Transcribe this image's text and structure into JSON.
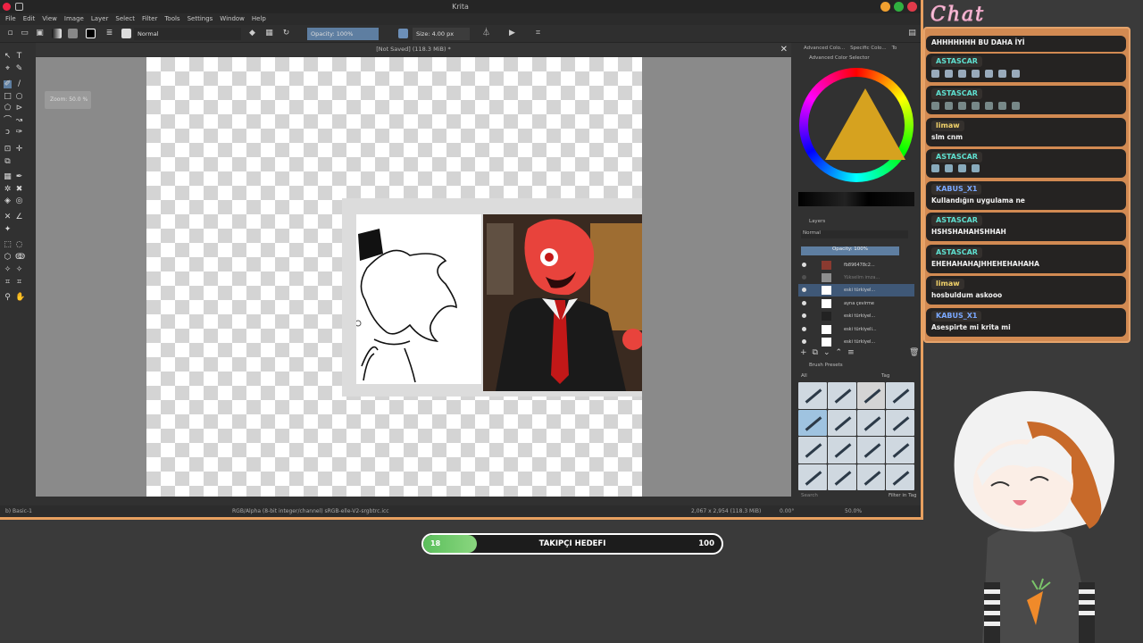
{
  "app": {
    "title": "Krita"
  },
  "menu": [
    "File",
    "Edit",
    "View",
    "Image",
    "Layer",
    "Select",
    "Filter",
    "Tools",
    "Settings",
    "Window",
    "Help"
  ],
  "toolbar": {
    "blend_mode": "Normal",
    "opacity": "Opacity: 100%",
    "size": "Size: 4.00 px"
  },
  "document": {
    "tab_title": "[Not Saved] (118.3 MiB) *"
  },
  "canvas": {
    "zoom_hint": "Zoom: 50.0 %"
  },
  "statusbar": {
    "brush": "b) Basic-1",
    "color_space": "RGB/Alpha (8-bit integer/channel) sRGB-elle-V2-srgbtrc.icc",
    "dimensions": "2,067 x 2,954 (118.3 MiB)",
    "rotation": "0.00°",
    "zoom": "50.0%"
  },
  "dockers": {
    "tabs": [
      "Advanced Colo...",
      "Specific Colo...",
      "To"
    ],
    "color_selector_title": "Advanced Color Selector",
    "layers_title": "Layers",
    "layers_blend": "Normal",
    "layers_opacity": "Opacity: 100%",
    "layers": [
      {
        "name": "fb896478c2..."
      },
      {
        "name": "Yükselim imza..."
      },
      {
        "name": "eski türkiyel..."
      },
      {
        "name": "ayna çevirme"
      },
      {
        "name": "eski türkiyel..."
      },
      {
        "name": "eski türkiyeli..."
      },
      {
        "name": "eski türkiyel..."
      }
    ],
    "brush_presets_title": "Brush Presets",
    "brush_filter": "All",
    "brush_tag": "Tag",
    "brush_search": "Search",
    "filter_in_tag": "Filter in Tag"
  },
  "chat": {
    "logo": "Chat",
    "messages": [
      {
        "user": "",
        "text": "AHHHHHHH BU DAHA İYİ",
        "user_color": "#ffffff"
      },
      {
        "user": "ASTASCAR",
        "text": "",
        "emotes": 7,
        "user_color": "#5ee0d0"
      },
      {
        "user": "ASTASCAR",
        "text": "",
        "emotes": 7,
        "user_color": "#5ee0d0"
      },
      {
        "user": "limaw",
        "text": "slm cnm",
        "user_color": "#f3d36a"
      },
      {
        "user": "ASTASCAR",
        "text": "",
        "emotes": 4,
        "user_color": "#5ee0d0"
      },
      {
        "user": "KABUS_X1",
        "text": "Kullandığın uygulama ne",
        "user_color": "#7aa8ff"
      },
      {
        "user": "ASTASCAR",
        "text": "HSHSHAHAHSHHAH",
        "user_color": "#5ee0d0"
      },
      {
        "user": "ASTASCAR",
        "text": "EHEHAHAHAJHHEHEHAHAHA",
        "user_color": "#5ee0d0"
      },
      {
        "user": "limaw",
        "text": "hosbuldum askooo",
        "user_color": "#f3d36a"
      },
      {
        "user": "KABUS_X1",
        "text": "Asespirte mi krita mi",
        "user_color": "#7aa8ff"
      }
    ]
  },
  "goal": {
    "current": "18",
    "label": "TAKIPÇI HEDEFI",
    "target": "100",
    "progress": 0.18
  },
  "colors": {
    "accent": "#e8a060",
    "selection": "#3f5877",
    "goal_green": "#5bbf5c"
  }
}
